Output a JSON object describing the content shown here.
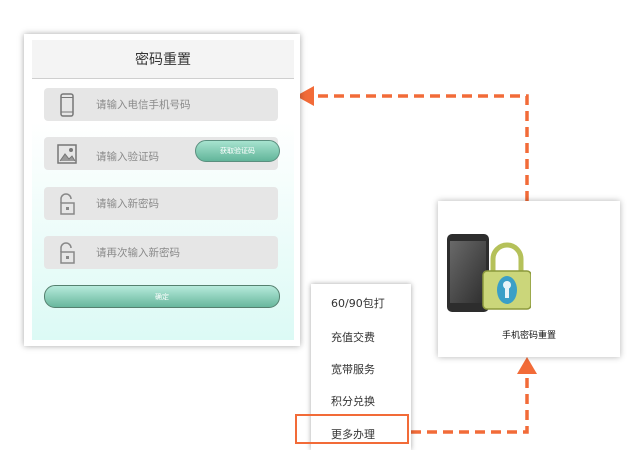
{
  "reset_form": {
    "title": "密码重置",
    "phone_placeholder": "请输入电信手机号码",
    "code_placeholder": "请输入验证码",
    "get_code_label": "获取验证码",
    "new_password_placeholder": "请输入新密码",
    "confirm_password_placeholder": "请再次输入新密码",
    "confirm_label": "确定",
    "icons": [
      "phone-icon",
      "image-icon",
      "unlock-icon",
      "unlock-icon"
    ]
  },
  "menu": {
    "items": [
      "60/90包打",
      "充值交费",
      "宽带服务",
      "积分兑换",
      "更多办理"
    ],
    "highlighted_index": 4
  },
  "feature_card": {
    "label": "手机密码重置",
    "icon": "phone-lock-icon"
  },
  "colors": {
    "arrow": "#f26b38",
    "button_green": "#68b79d"
  }
}
